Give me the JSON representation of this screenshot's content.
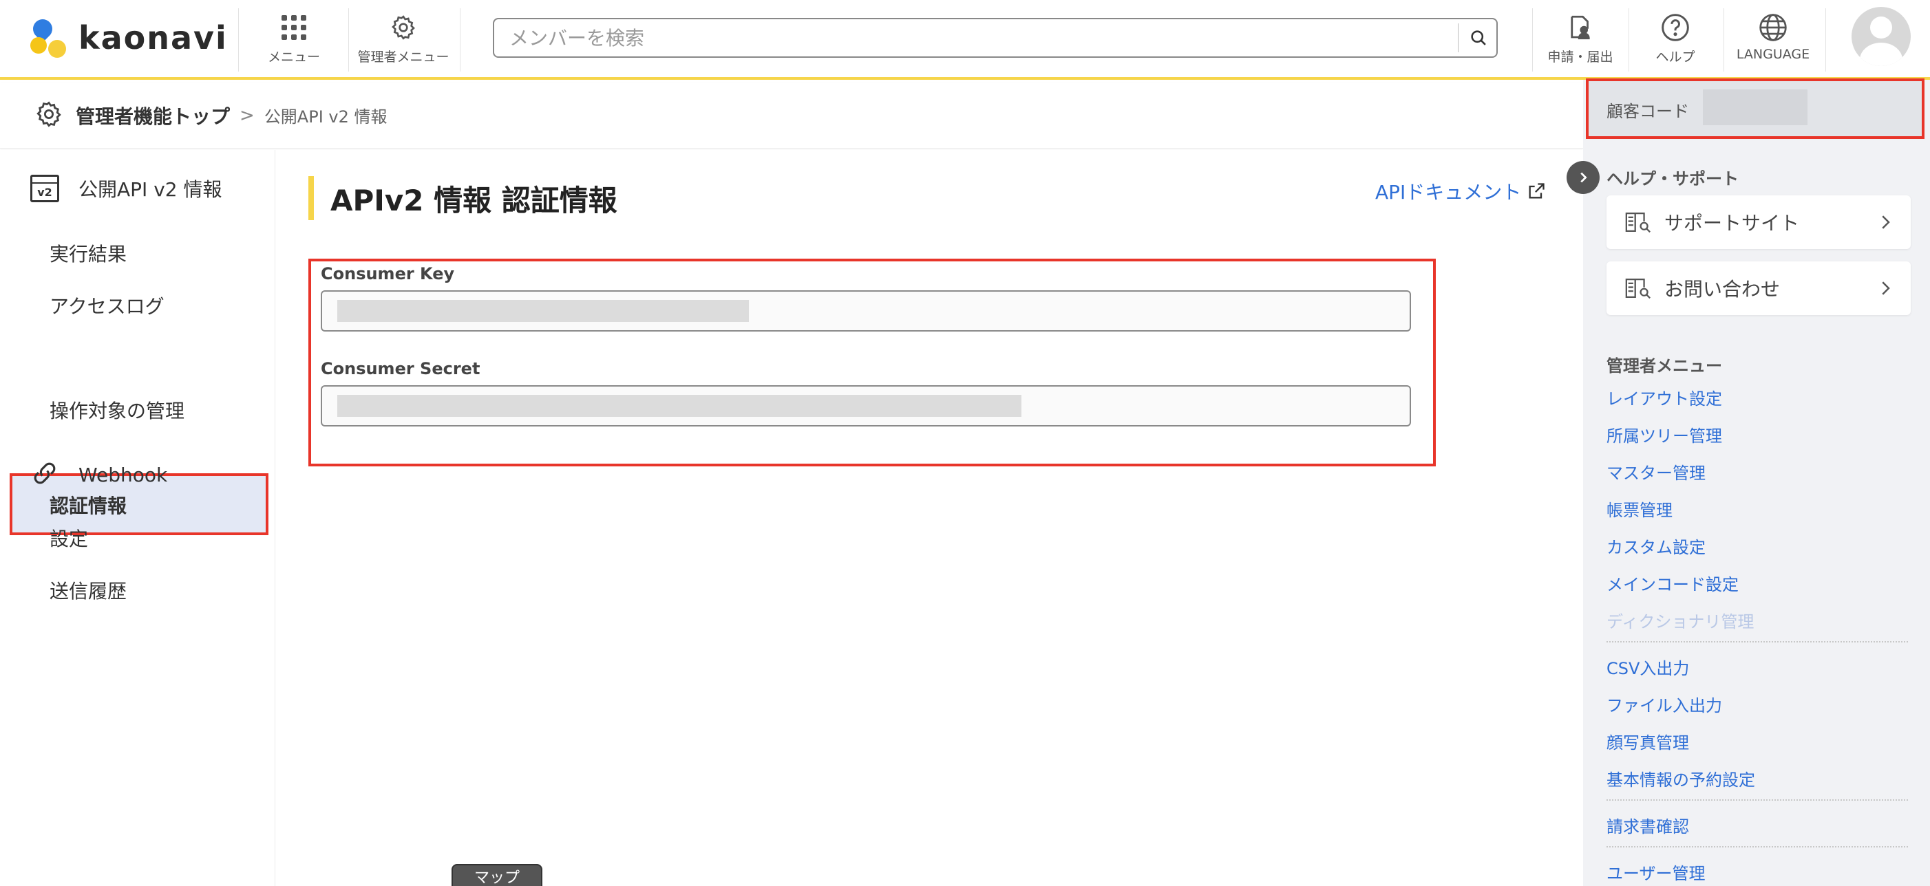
{
  "header": {
    "logo_text": "kaonavi",
    "menu_label": "メニュー",
    "admin_menu_label": "管理者メニュー",
    "search_placeholder": "メンバーを検索",
    "request_label": "申請・届出",
    "help_label": "ヘルプ",
    "language_label": "LANGUAGE"
  },
  "breadcrumb": {
    "top": "管理者機能トップ",
    "separator": ">",
    "current": "公開API v2 情報"
  },
  "left_sidebar": {
    "group1_label": "公開API v2 情報",
    "group1_icon_text": "v2",
    "group1_items": [
      "実行結果",
      "アクセスログ",
      "認証情報",
      "操作対象の管理"
    ],
    "group2_label": "Webhook",
    "group2_items": [
      "設定",
      "送信履歴"
    ]
  },
  "main": {
    "page_title": "APIv2 情報 認証情報",
    "api_doc_link": "APIドキュメント",
    "consumer_key_label": "Consumer Key",
    "consumer_secret_label": "Consumer Secret",
    "map_tab": "マップ"
  },
  "right_sidebar": {
    "customer_code_label": "顧客コード",
    "help_support_title": "ヘルプ・サポート",
    "support_site": "サポートサイト",
    "contact": "お問い合わせ",
    "admin_menu_title": "管理者メニュー",
    "links_group1": [
      "レイアウト設定",
      "所属ツリー管理",
      "マスター管理",
      "帳票管理",
      "カスタム設定",
      "メインコード設定"
    ],
    "link_disabled": "ディクショナリ管理",
    "links_group2": [
      "CSV入出力",
      "ファイル入出力",
      "顔写真管理",
      "基本情報の予約設定"
    ],
    "links_group3": [
      "請求書確認"
    ],
    "links_group4": [
      "ユーザー管理"
    ]
  },
  "colors": {
    "accent_yellow": "#f6d54a",
    "highlight_red": "#e8352a",
    "link_blue": "#2f6fd6",
    "active_bg": "#e3e8f5"
  }
}
